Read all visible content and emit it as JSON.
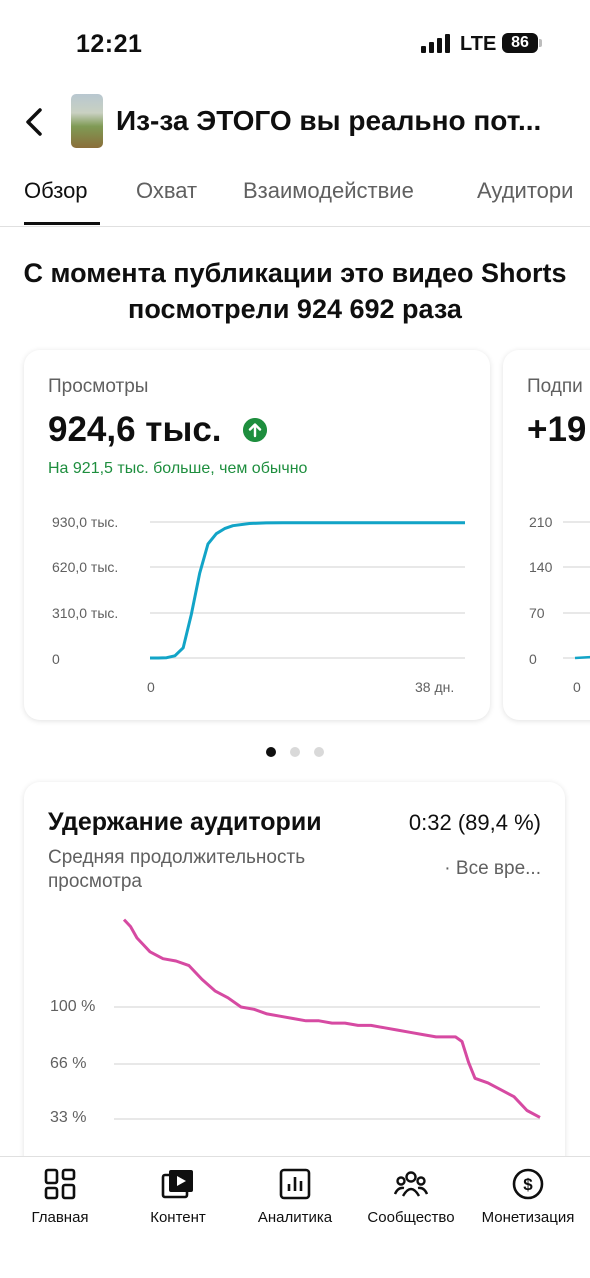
{
  "status_bar": {
    "time": "12:21",
    "network": "LTE",
    "battery": "86"
  },
  "header": {
    "title": "Из-за ЭТОГО вы реально пот..."
  },
  "tabs": [
    {
      "label": "Обзор",
      "active": true
    },
    {
      "label": "Охват",
      "active": false
    },
    {
      "label": "Взаимодействие",
      "active": false
    },
    {
      "label": "Аудитори",
      "active": false
    }
  ],
  "headline": "С момента публикации это видео Shorts посмотрели 924 692 раза",
  "views_card": {
    "label": "Просмотры",
    "value": "924,6 тыс.",
    "delta": "На 921,5 тыс. больше, чем обычно",
    "y_ticks": [
      "930,0 тыс.",
      "620,0 тыс.",
      "310,0 тыс.",
      "0"
    ],
    "x_ticks": [
      "0",
      "38 дн."
    ],
    "line_color": "#12a4c7"
  },
  "subs_card": {
    "label": "Подпи",
    "value": "+19",
    "y_ticks": [
      "210",
      "140",
      "70",
      "0"
    ],
    "x_ticks": [
      "0"
    ]
  },
  "carousel": {
    "pages": 3,
    "active": 0
  },
  "retention": {
    "title": "Удержание аудитории",
    "value": "0:32 (89,4 %)",
    "subtitle": "Средняя продолжительность просмотра",
    "period": "· Все вре...",
    "y_ticks": [
      "100 %",
      "66 %",
      "33 %"
    ],
    "line_color": "#d64aa2"
  },
  "chart_data": [
    {
      "type": "line",
      "x": [
        0,
        1,
        2,
        3,
        4,
        5,
        6,
        7,
        8,
        9,
        10,
        12,
        14,
        16,
        20,
        25,
        30,
        35,
        38
      ],
      "series": [
        {
          "values": [
            0,
            0,
            2,
            15,
            70,
            300,
            580,
            780,
            850,
            885,
            905,
            920,
            924,
            924.5,
            924.6,
            924.6,
            924.6,
            924.6,
            924.6
          ]
        }
      ],
      "ylabel": "тыс.",
      "ylim": [
        0,
        930
      ],
      "xlim": [
        0,
        38
      ],
      "grid": true
    },
    {
      "type": "line",
      "x": [
        0,
        0.5,
        1,
        1.5,
        2,
        3,
        4,
        5,
        6,
        7,
        8,
        9,
        10,
        11,
        12,
        13,
        14,
        15,
        16,
        17,
        18,
        19,
        20,
        21,
        22,
        23,
        24,
        25,
        25.5,
        26,
        26.5,
        27,
        28,
        29,
        30,
        31,
        32
      ],
      "series": [
        {
          "values": [
            138,
            135,
            130,
            127,
            124,
            121,
            120,
            118,
            112,
            107,
            104,
            100,
            99,
            97,
            96,
            95,
            94,
            94,
            93,
            93,
            92,
            92,
            91,
            90,
            89,
            88,
            87,
            87,
            87,
            85,
            76,
            69,
            67,
            64,
            61,
            55,
            52
          ]
        }
      ],
      "ylim": [
        0,
        140
      ],
      "y_ticks": [
        "100 %",
        "66 %",
        "33 %"
      ],
      "grid": true
    }
  ]
}
